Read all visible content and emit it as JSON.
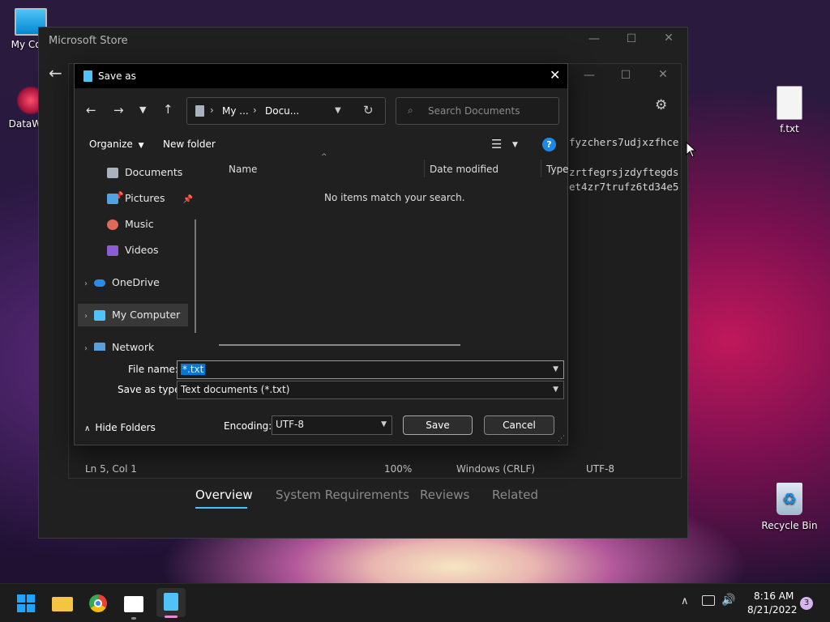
{
  "desktop": {
    "icons": [
      {
        "label": "My Com"
      },
      {
        "label": "DataWag"
      },
      {
        "label": "f.txt"
      },
      {
        "label": "Recycle Bin"
      }
    ]
  },
  "store": {
    "title": "Microsoft Store",
    "tabs": [
      "Overview",
      "System Requirements",
      "Reviews",
      "Related"
    ]
  },
  "notepad": {
    "lines": [
      "fyzchers7udjxzfhce",
      "zrtfegrsjzdyftegds",
      "et4zr7trufz6td34e5"
    ],
    "status": {
      "position": "Ln 5, Col 1",
      "zoom": "100%",
      "line_ending": "Windows (CRLF)",
      "encoding": "UTF-8"
    }
  },
  "dialog": {
    "title": "Save as",
    "address": {
      "part1": "My ...",
      "part2": "Docu..."
    },
    "search_placeholder": "Search Documents",
    "toolbar": {
      "organize": "Organize",
      "new_folder": "New folder"
    },
    "tree": [
      {
        "label": "Documents",
        "pinned": true
      },
      {
        "label": "Pictures",
        "pinned": true
      },
      {
        "label": "Music"
      },
      {
        "label": "Videos"
      },
      {
        "label": "OneDrive"
      },
      {
        "label": "My Computer"
      },
      {
        "label": "Network"
      }
    ],
    "columns": {
      "name": "Name",
      "date": "Date modified",
      "type": "Type"
    },
    "empty_message": "No items match your search.",
    "file_name_label": "File name:",
    "file_name_value": "*.txt",
    "save_type_label": "Save as type:",
    "save_type_value": "Text documents (*.txt)",
    "hide_folders": "Hide Folders",
    "encoding_label": "Encoding:",
    "encoding_value": "UTF-8",
    "save": "Save",
    "cancel": "Cancel"
  },
  "taskbar": {
    "time": "8:16 AM",
    "date": "8/21/2022",
    "notifications": "3"
  },
  "colors": {
    "accent": "#4cc2ff",
    "highlight": "#0078d4",
    "help": "#1e88e5"
  }
}
